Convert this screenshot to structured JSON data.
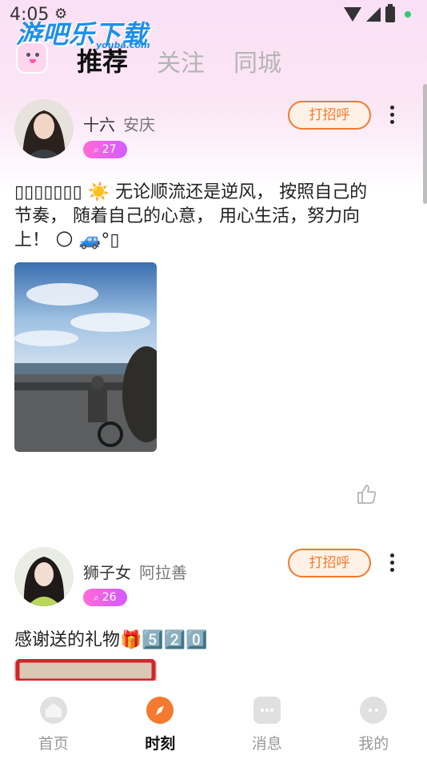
{
  "status_bar": {
    "time": "4:05"
  },
  "watermark": {
    "text": "游吧乐下载",
    "sub": "youba.com"
  },
  "header": {
    "tabs": [
      {
        "label": "推荐",
        "active": true
      },
      {
        "label": "关注",
        "active": false
      },
      {
        "label": "同城",
        "active": false
      }
    ]
  },
  "posts": [
    {
      "username": "十六",
      "location": "安庆",
      "badge_count": "27",
      "greet_label": "打招呼",
      "text_line1": "▯▯▯▯▯▯▯ ☀️ 无论顺流还是逆风， 按照自己的",
      "text_line2": "节奏， 随着自己的心意， 用心生活，努力向",
      "text_line3": "上！ 🌕 🚙°▯"
    },
    {
      "username": "狮子女",
      "location": "阿拉善",
      "badge_count": "26",
      "greet_label": "打招呼",
      "text_line1": "感谢送的礼物🎁5️⃣2️⃣0️⃣"
    }
  ],
  "bottom_nav": [
    {
      "label": "首页",
      "active": false
    },
    {
      "label": "时刻",
      "active": true
    },
    {
      "label": "消息",
      "active": false
    },
    {
      "label": "我的",
      "active": false
    }
  ],
  "colors": {
    "accent": "#f37a2e",
    "badge": "#e05bf0",
    "header_bg": "#fbe0f5"
  }
}
